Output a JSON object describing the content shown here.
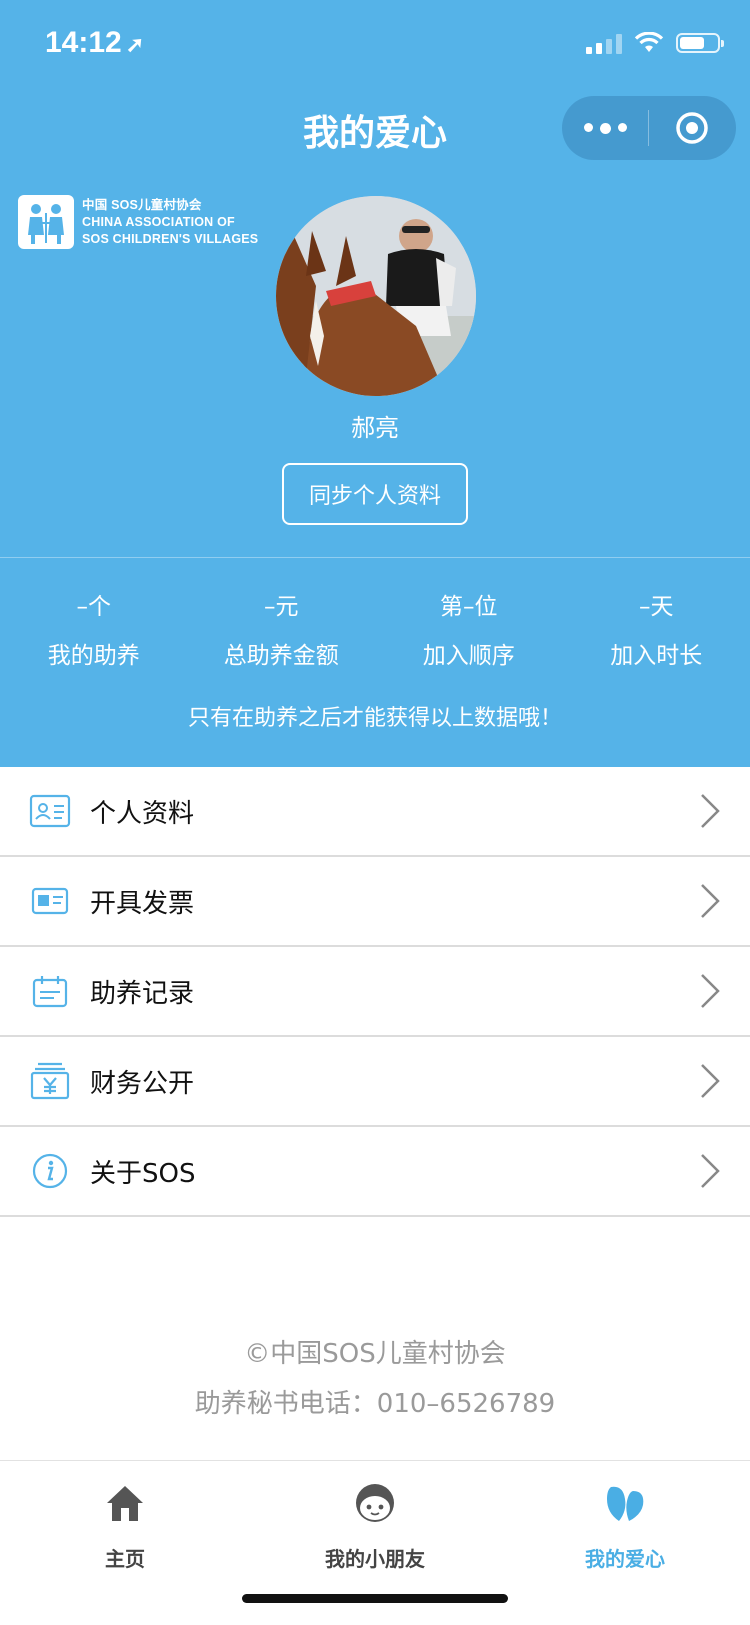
{
  "status_bar": {
    "time": "14:12"
  },
  "nav": {
    "title": "我的爱心"
  },
  "logo": {
    "line1": "中国 SOS儿童村协会",
    "line2": "CHINA ASSOCIATION OF",
    "line3": "SOS CHILDREN'S VILLAGES"
  },
  "profile": {
    "name": "郝亮",
    "sync_button": "同步个人资料"
  },
  "stats": [
    {
      "value": "–个",
      "label": "我的助养"
    },
    {
      "value": "–元",
      "label": "总助养金额"
    },
    {
      "value": "第–位",
      "label": "加入顺序"
    },
    {
      "value": "–天",
      "label": "加入时长"
    }
  ],
  "stats_note": "只有在助养之后才能获得以上数据哦！",
  "menu": [
    {
      "label": "个人资料",
      "icon": "id-card-icon"
    },
    {
      "label": "开具发票",
      "icon": "invoice-icon"
    },
    {
      "label": "助养记录",
      "icon": "calendar-icon"
    },
    {
      "label": "财务公开",
      "icon": "finance-icon"
    },
    {
      "label": "关于SOS",
      "icon": "info-icon"
    }
  ],
  "footer": {
    "copyright": "©中国SOS儿童村协会",
    "phone": "助养秘书电话：010–6526789"
  },
  "tabs": [
    {
      "label": "主页",
      "icon": "home-icon",
      "active": false
    },
    {
      "label": "我的小朋友",
      "icon": "child-face-icon",
      "active": false
    },
    {
      "label": "我的爱心",
      "icon": "heart-icon",
      "active": true
    }
  ],
  "colors": {
    "primary": "#55b3e8",
    "active_tab": "#4aaee4",
    "text_muted": "#9a9a9a"
  }
}
